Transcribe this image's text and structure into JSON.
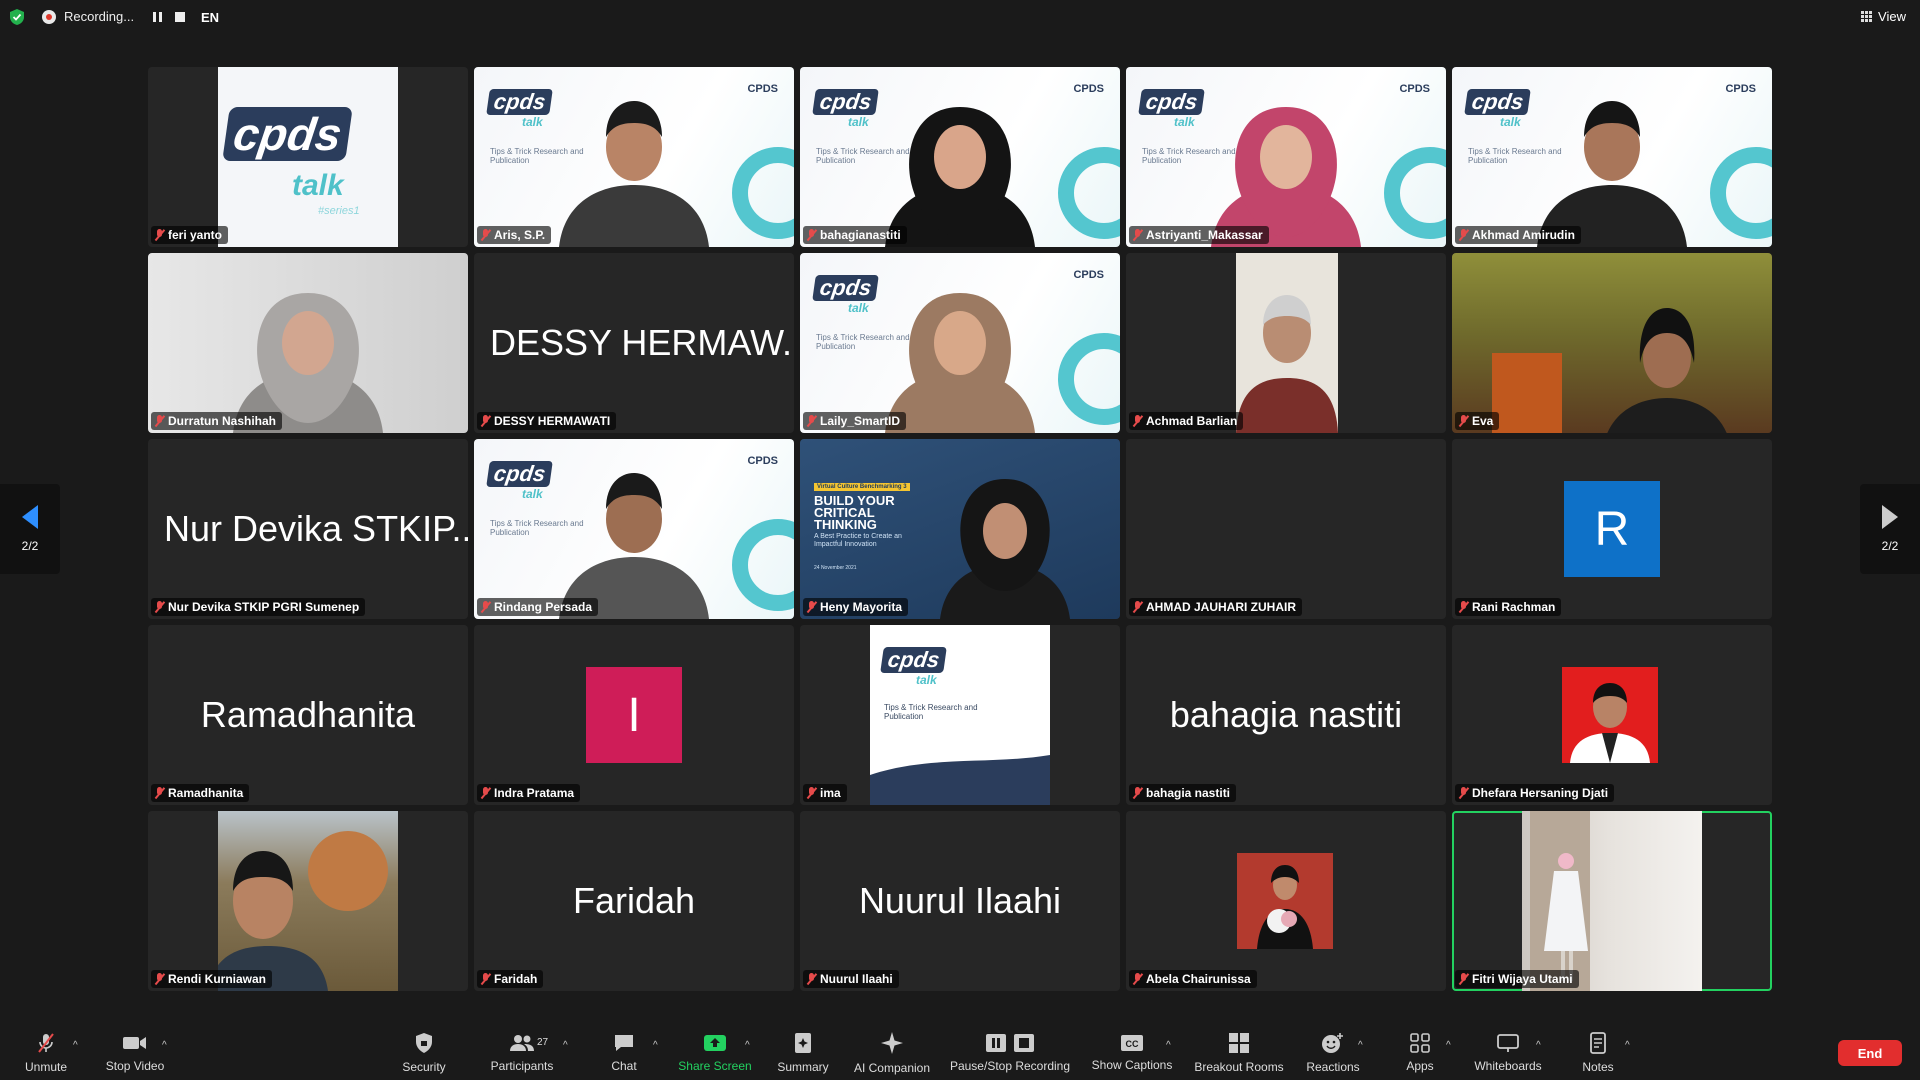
{
  "topbar": {
    "recording_label": "Recording...",
    "language": "EN",
    "view_label": "View"
  },
  "pager": {
    "left": "2/2",
    "right": "2/2"
  },
  "tiles": [
    {
      "name": "feri yanto",
      "video": "cpds-logo"
    },
    {
      "name": "Aris, S.P.",
      "video": "cpds-man"
    },
    {
      "name": "bahagianastiti",
      "video": "cpds-hijab-black"
    },
    {
      "name": "Astriyanti_Makassar",
      "video": "cpds-hijab-pink"
    },
    {
      "name": "Akhmad Amirudin",
      "video": "cpds-man2"
    },
    {
      "name": "Durratun Nashihah",
      "video": "hijab-room"
    },
    {
      "name": "DESSY HERMAWATI",
      "big": "DESSY HERMAW..."
    },
    {
      "name": "Laily_SmartID",
      "video": "cpds-hijab-brown"
    },
    {
      "name": "Achmad Barlian",
      "video": "car-man"
    },
    {
      "name": "Eva",
      "video": "room-woman"
    },
    {
      "name": "Nur Devika STKIP PGRI Sumenep",
      "big": "Nur Devika STKIP..."
    },
    {
      "name": "Rindang Persada",
      "video": "cpds-man3"
    },
    {
      "name": "Heny Mayorita",
      "video": "critical-thinking",
      "banner": [
        "Virtual Culture Benchmarking 3",
        "BUILD YOUR",
        "CRITICAL",
        "THINKING",
        "A Best Practice to Create an Impactful Innovation",
        "24 November 2021"
      ]
    },
    {
      "name": "AHMAD JAUHARI ZUHAIR",
      "video": "blank"
    },
    {
      "name": "Rani Rachman",
      "avatar": "R",
      "avatar_color": "#0e71c8"
    },
    {
      "name": "Ramadhanita",
      "big": "Ramadhanita"
    },
    {
      "name": "Indra Pratama",
      "avatar": "I",
      "avatar_color": "#cf1d58"
    },
    {
      "name": "ima",
      "video": "cpds-poster"
    },
    {
      "name": "bahagia nastiti",
      "big": "bahagia nastiti"
    },
    {
      "name": "Dhefara Hersaning Djati",
      "video": "red-photo"
    },
    {
      "name": "Rendi Kurniawan",
      "video": "selfie-trees"
    },
    {
      "name": "Faridah",
      "big": "Faridah"
    },
    {
      "name": "Nuurul Ilaahi",
      "big": "Nuurul Ilaahi"
    },
    {
      "name": "Abela Chairunissa",
      "video": "bouquet"
    },
    {
      "name": "Fitri Wijaya Utami",
      "video": "mirror",
      "active": true
    }
  ],
  "cpds": {
    "brand_top": "cpds",
    "brand_bottom": "talk",
    "series": "#series1",
    "corner": "CPDS",
    "subtitle": "Tips & Trick Research and Publication"
  },
  "toolbar": {
    "unmute": "Unmute",
    "stop_video": "Stop Video",
    "security": "Security",
    "participants": "Participants",
    "participants_count": "27",
    "chat": "Chat",
    "share_screen": "Share Screen",
    "summary": "Summary",
    "ai_companion": "AI Companion",
    "pause_stop_recording": "Pause/Stop Recording",
    "show_captions": "Show Captions",
    "breakout_rooms": "Breakout Rooms",
    "reactions": "Reactions",
    "apps": "Apps",
    "whiteboards": "Whiteboards",
    "notes": "Notes",
    "end": "End",
    "cc_icon_text": "CC"
  },
  "colors": {
    "accent_green": "#23d160",
    "end_red": "#e22e2e",
    "share_green": "#23d160",
    "nav_blue": "#2e8fff"
  }
}
